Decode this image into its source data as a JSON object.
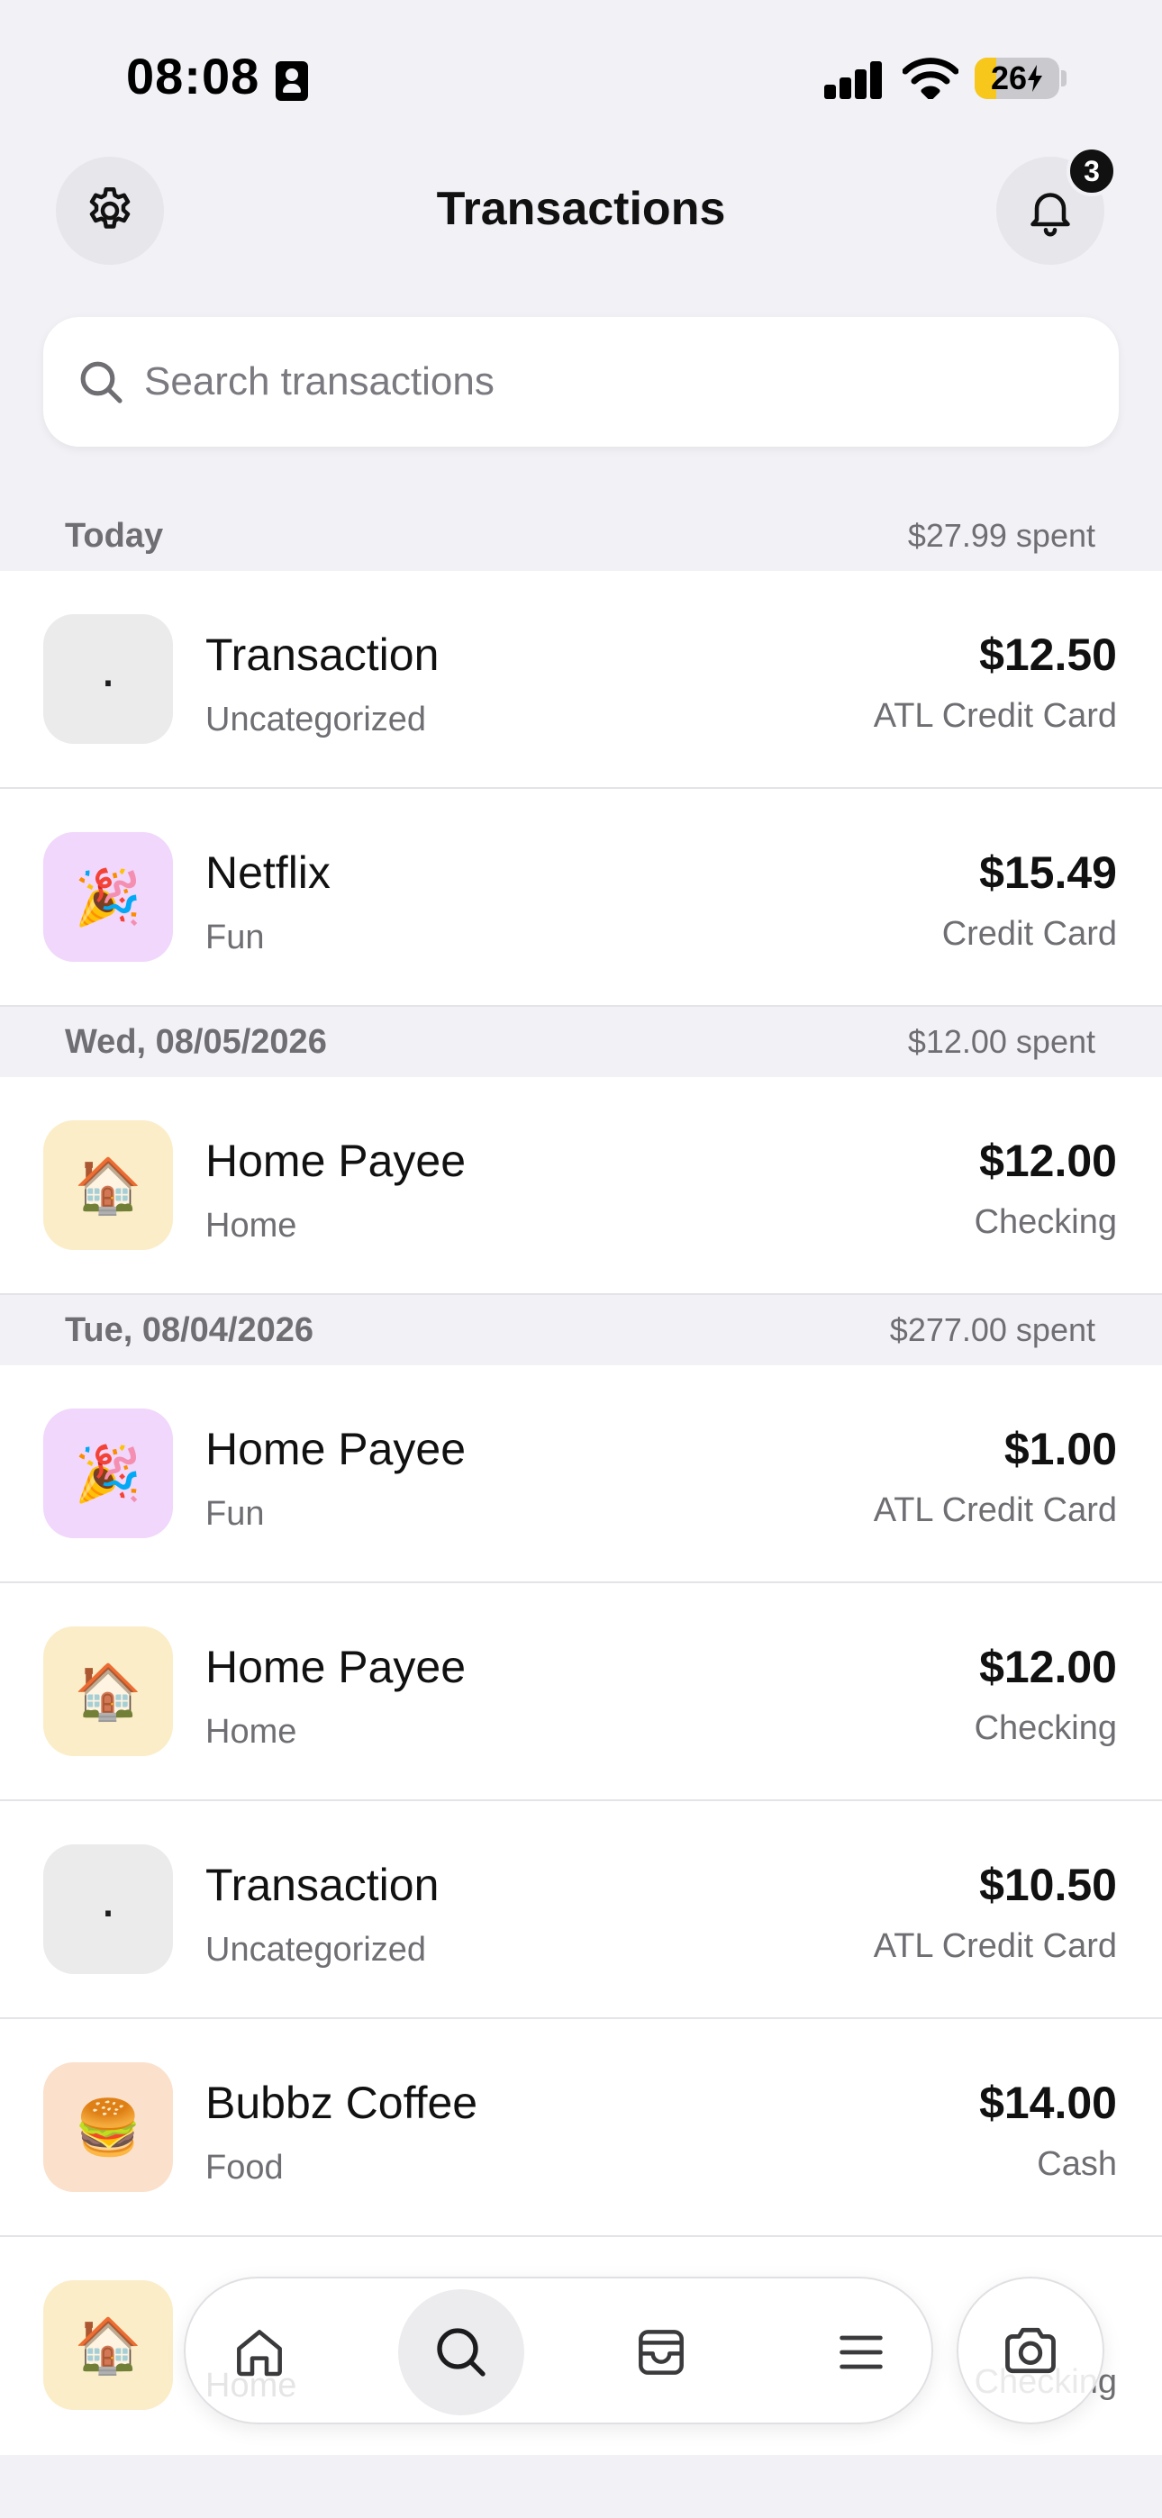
{
  "status_bar": {
    "time": "08:08",
    "battery": "26",
    "battery_level": 0.26
  },
  "header": {
    "title": "Transactions",
    "notification_count": "3",
    "icons": {
      "settings": "gear-icon",
      "notifications": "bell-icon"
    }
  },
  "search": {
    "placeholder": "Search transactions",
    "value": ""
  },
  "sections": [
    {
      "title": "Today",
      "spent": "$27.99 spent",
      "transactions": [
        {
          "name": "Transaction",
          "category": "Uncategorized",
          "amount": "$12.50",
          "account": "ATL Credit Card",
          "emoji": "·",
          "icon_color": "#ebebeb"
        },
        {
          "name": "Netflix",
          "category": "Fun",
          "amount": "$15.49",
          "account": "Credit Card",
          "emoji": "🎉",
          "icon_color": "#f0d7fb"
        }
      ]
    },
    {
      "title": "Wed, 08/05/2026",
      "spent": "$12.00 spent",
      "transactions": [
        {
          "name": "Home Payee",
          "category": "Home",
          "amount": "$12.00",
          "account": "Checking",
          "emoji": "🏠",
          "icon_color": "#fbedc8"
        }
      ]
    },
    {
      "title": "Tue, 08/04/2026",
      "spent": "$277.00 spent",
      "transactions": [
        {
          "name": "Home Payee",
          "category": "Fun",
          "amount": "$1.00",
          "account": "ATL Credit Card",
          "emoji": "🎉",
          "icon_color": "#f0d7fb"
        },
        {
          "name": "Home Payee",
          "category": "Home",
          "amount": "$12.00",
          "account": "Checking",
          "emoji": "🏠",
          "icon_color": "#fbedc8"
        },
        {
          "name": "Transaction",
          "category": "Uncategorized",
          "amount": "$10.50",
          "account": "ATL Credit Card",
          "emoji": "·",
          "icon_color": "#ebebeb"
        },
        {
          "name": "Bubbz Coffee",
          "category": "Food",
          "amount": "$14.00",
          "account": "Cash",
          "emoji": "🍔",
          "icon_color": "#fbe0cb"
        },
        {
          "name": "",
          "category": "Home",
          "amount": "",
          "account": "Checking",
          "emoji": "🏠",
          "icon_color": "#fbedc8"
        }
      ]
    }
  ],
  "tab_bar": {
    "tabs": [
      {
        "name": "home",
        "icon": "home-icon",
        "active": false
      },
      {
        "name": "search",
        "icon": "search-icon",
        "active": true
      },
      {
        "name": "inbox",
        "icon": "inbox-icon",
        "active": false
      },
      {
        "name": "menu",
        "icon": "menu-icon",
        "active": false
      }
    ],
    "camera_icon": "camera-icon"
  },
  "colors": {
    "background": "#f1f1f6",
    "card": "#ffffff",
    "text_primary": "#111111",
    "text_secondary": "#6e6e73",
    "battery": "#f7c71c"
  }
}
